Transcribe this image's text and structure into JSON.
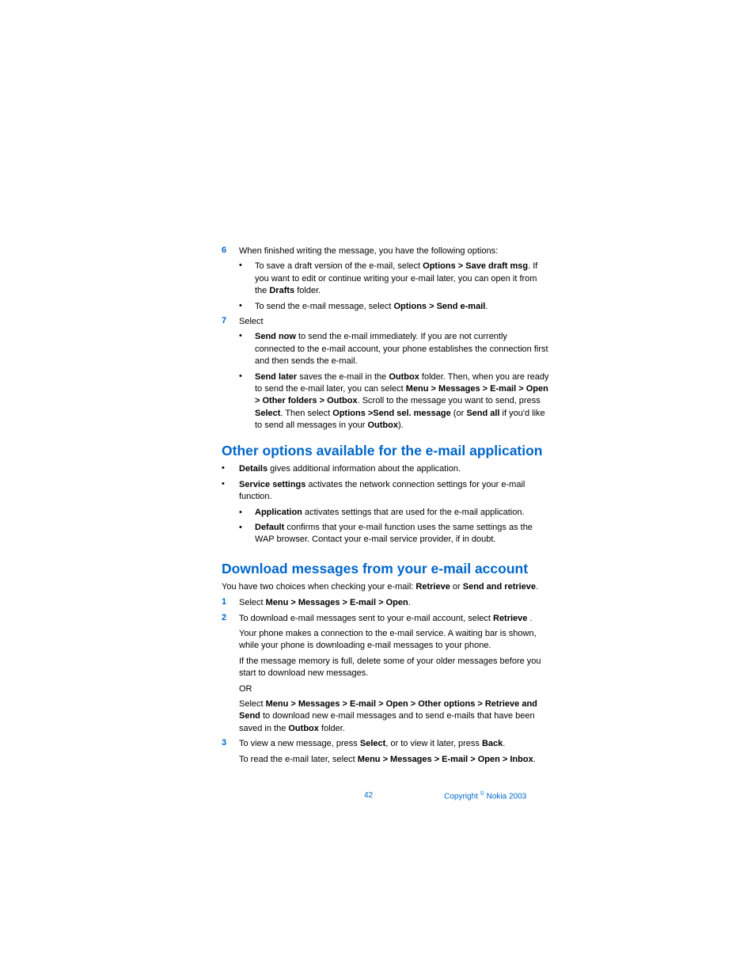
{
  "step6": {
    "num": "6",
    "text_a": "When finished writing the message, you have the following options:",
    "sub1_a": "To save a draft version of the e-mail, select ",
    "sub1_b": "Options > Save draft msg",
    "sub1_c": ". If you want to edit or continue writing your e-mail later, you can open it from the ",
    "sub1_d": "Drafts",
    "sub1_e": " folder.",
    "sub2_a": "To send the e-mail message, select ",
    "sub2_b": "Options > Send e-mail",
    "sub2_c": "."
  },
  "step7": {
    "num": "7",
    "text": "Select",
    "sub1_a": "Send now",
    "sub1_b": " to send the e-mail immediately. If you are not currently connected to the e-mail account, your phone establishes the connection first and then sends the e-mail.",
    "sub2_a": "Send later",
    "sub2_b": " saves the e-mail in the ",
    "sub2_c": "Outbox",
    "sub2_d": " folder. Then, when you are ready to send the e-mail later, you can select ",
    "sub2_e": "Menu > Messages > E-mail > Open > Other folders > Outbox",
    "sub2_f": ". Scroll to the message you want to send, press ",
    "sub2_g": "Select",
    "sub2_h": ". Then select ",
    "sub2_i": "Options >Send sel. message",
    "sub2_j": " (or ",
    "sub2_k": "Send all",
    "sub2_l": " if you'd like to send all messages in your ",
    "sub2_m": "Outbox",
    "sub2_n": ")."
  },
  "heading1": "Other options available for the e-mail application",
  "other": {
    "b1_a": "Details",
    "b1_b": " gives additional information about the application.",
    "b2_a": "Service settings",
    "b2_b": " activates the network connection settings for your e-mail function.",
    "b2_s1_a": "Application",
    "b2_s1_b": " activates settings that are used for the e-mail application.",
    "b2_s2_a": "Default",
    "b2_s2_b": " confirms that your e-mail function uses the same settings as the WAP browser. Contact your e-mail service provider, if in doubt."
  },
  "heading2": "Download messages from your e-mail account",
  "download": {
    "intro_a": "You have two choices when checking your e-mail: ",
    "intro_b": "Retrieve",
    "intro_c": " or ",
    "intro_d": "Send and retrieve",
    "intro_e": ".",
    "s1_num": "1",
    "s1_a": "Select ",
    "s1_b": "Menu > Messages > E-mail > Open",
    "s1_c": ".",
    "s2_num": "2",
    "s2_a": "To download e-mail messages sent to your e-mail account, select ",
    "s2_b": "Retrieve",
    "s2_c": " .",
    "s2_p2": "Your phone makes a connection to the e-mail service. A waiting bar is shown, while your phone is downloading e-mail messages to your phone.",
    "s2_p3": "If the message memory is full, delete some of your older messages before you start to download new messages.",
    "s2_or": "OR",
    "s2_p4_a": "Select ",
    "s2_p4_b": "Menu > Messages > E-mail > Open > Other options > Retrieve and Send",
    "s2_p4_c": " to download new e-mail messages and to send e-mails that have been saved in the ",
    "s2_p4_d": "Outbox",
    "s2_p4_e": " folder.",
    "s3_num": "3",
    "s3_a": "To view a new message, press ",
    "s3_b": "Select",
    "s3_c": ", or to view it later, press ",
    "s3_d": "Back",
    "s3_e": ".",
    "s3_p2_a": "To read the e-mail later, select ",
    "s3_p2_b": "Menu > Messages > E-mail > Open > Inbox",
    "s3_p2_c": "."
  },
  "footer": {
    "page": "42",
    "copyright_a": "Copyright ",
    "copyright_b": "©",
    "copyright_c": " Nokia 2003"
  }
}
